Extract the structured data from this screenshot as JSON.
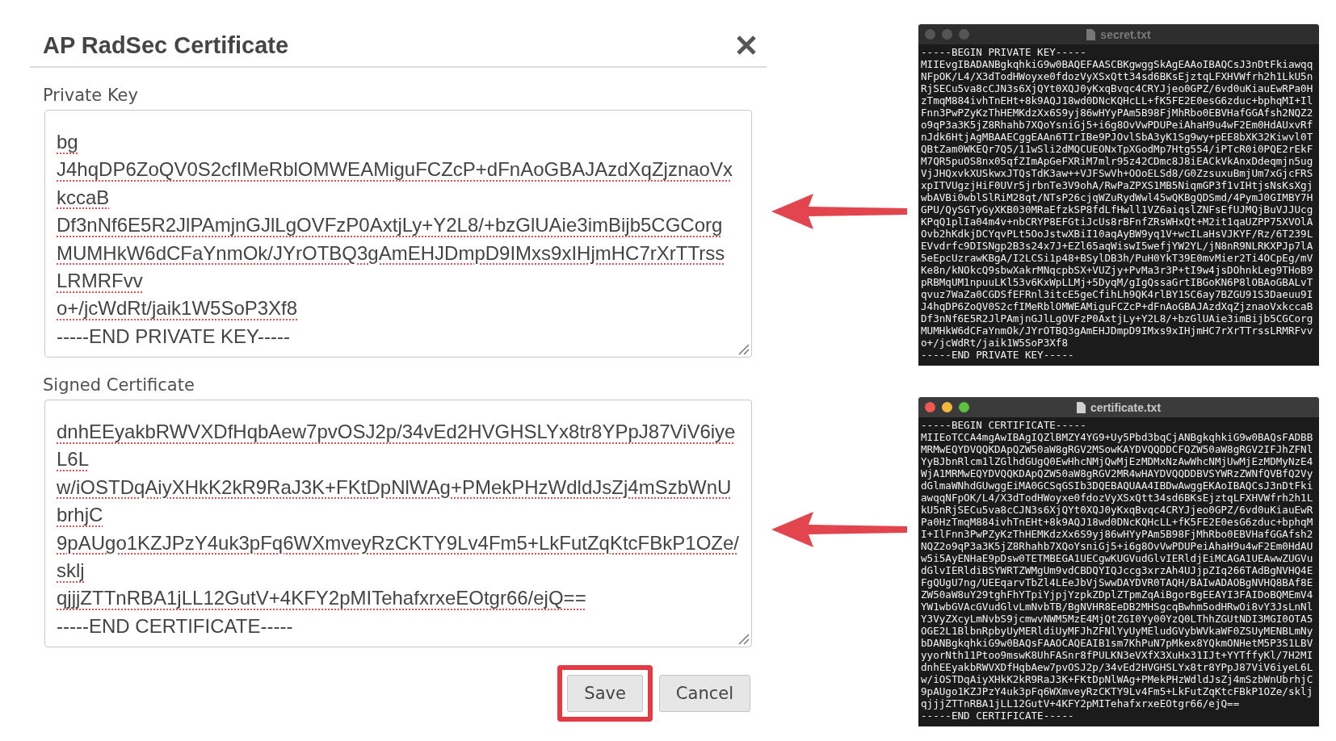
{
  "dialog": {
    "title": "AP RadSec Certificate",
    "fields": [
      {
        "label": "Private Key",
        "lines": [
          {
            "text": "bg",
            "misspelled": true
          },
          {
            "text": "J4hqDP6ZoQV0S2cfIMeRblOMWEAMiguFCZcP+dFnAoGBAJAzdXqZjznaoVx",
            "misspelled": true
          },
          {
            "text": "kccaB",
            "misspelled": true
          },
          {
            "text": "Df3nNf6E5R2JlPAmjnGJlLgOVFzP0AxtjLy+Y2L8/+bzGlUAie3imBijb5CGCorg",
            "misspelled": true
          },
          {
            "text": "MUMHkW6dCFaYnmOk/JYrOTBQ3gAmEHJDmpD9IMxs9xIHjmHC7rXrTTrss",
            "misspelled": true
          },
          {
            "text": "LRMRFvv",
            "misspelled": true
          },
          {
            "text": "o+/jcWdRt/jaik1W5SoP3Xf8",
            "misspelled": true
          },
          {
            "text": "-----END PRIVATE KEY-----",
            "misspelled": false
          }
        ]
      },
      {
        "label": "Signed Certificate",
        "lines": [
          {
            "text": "dnhEEyakbRWVXDfHqbAew7pvOSJ2p/34vEd2HVGHSLYx8tr8YPpJ87ViV6iye",
            "misspelled": true
          },
          {
            "text": "L6L",
            "misspelled": true
          },
          {
            "text": "w/iOSTDqAiyXHkK2kR9RaJ3K+FKtDpNlWAg+PMekPHzWdldJsZj4mSzbWnU",
            "misspelled": true
          },
          {
            "text": "brhjC",
            "misspelled": true
          },
          {
            "text": "9pAUgo1KZJPzY4uk3pFq6WXmveyRzCKTY9Lv4Fm5+LkFutZqKtcFBkP1OZe/",
            "misspelled": true
          },
          {
            "text": "sklj",
            "misspelled": true
          },
          {
            "text": "qjjjZTTnRBA1jLL12GutV+4KFY2pMITehafxrxeEOtgr66/ejQ==",
            "misspelled": true
          },
          {
            "text": "-----END CERTIFICATE-----",
            "misspelled": false
          }
        ]
      }
    ],
    "buttons": [
      {
        "label": "Save",
        "highlighted": true
      },
      {
        "label": "Cancel",
        "highlighted": false
      }
    ]
  },
  "terminals": [
    {
      "title": "secret.txt",
      "active": false,
      "lines": [
        "-----BEGIN PRIVATE KEY-----",
        "MIIEvgIBADANBgkqhkiG9w0BAQEFAASCBKgwggSkAgEAAoIBAQCsJ3nDtFkiawqq",
        "NFpOK/L4/X3dTodHWoyxe0fdozVyXSxQtt34sd6BKsEjztqLFXHVWfrh2h1LkU5n",
        "RjSECu5va8cCJN3s6XjQYt0XQJ0yKxqBvqc4CRYJjeo0GPZ/6vd0uKiauEwRPa0H",
        "zTmqM884ivhTnEHt+8k9AQJ18wd0DNcKQHcLL+fK5FE2E0esG6zduc+bphqMI+Il",
        "Fnn3PwPZyKzThHEMKdzXx6S9yj86wHYyPAm5B98FjMhRbo0EBVHafGGAfsh2NQZ2",
        "o9qP3a3K5jZ8Rhahb7XQoYsniGj5+i6g8OvVwPDUPeiAhaH9u4wF2Em0HdAUxvRf",
        "nJdk6HtjAgMBAAECggEAAn6TIrIBe9PJOvlSbA3yK1Sg9wy+pEE8bXK32Kiwvl0T",
        "QBtZam0WKEQr7Q5/11wSli2dMQCUEONxTpXGodMp7Htg554/iPTcR0i0PQE2rEkF",
        "M7QR5puOS8nx05qfZImApGeFXRiM7mlr95z42CDmc8J8iEACkVkAnxDdeqmjn5ug",
        "VjJHQxvkXUSkwxJTQsTdK3aw++VJFSwVh+OOoELSd8/G0ZzsuxuBmjUm7xGjcFRS",
        "xpITVUgzjHiF0UVr5jrbnTe3V9ohA/RwPaZPXS1MB5NiqmGP3f1vIHtjsNsKsXgj",
        "wbAVBi0wblSlRiM28qt/NTsP26cjqWZuRydWwl45wQKBgQDSmd/4PymJ0GIMBY7H",
        "GPU/QySGTyGyXKB030MRaEfzkSP8fdLfHwll1VZ6aiqslZNFsEfUJMQjBuVJJUcg",
        "KPqQ1plIa04m4v+nbCRYP8EFGtiJcUs8rBFnfZRsWHxQt+M2it1qaUZPP75XVOlA",
        "Ovb2hKdkjDCYqvPLt5OoJstwXBiI10aqAyBW9yq1V+wcILaHsVJKYF/Rz/6T239L",
        "EVvdrfc9DISNgp2B3s24x7J+EZl65aqWiswI5wefjYW2YL/jN8nR9NLRKXPJp7lA",
        "5eEpcUzrawKBgA/I2LCSi1p48+BSylDB3h/PuH0YkT39E0mvMier2Ti4OCpEg/mV",
        "Ke8n/kNOkcQ9sbwXakrMNqcpbSX+VUZjy+PvMa3r3P+tI9w4jsDOhnkLeg9THoB9",
        "pRBMqUM1npuuLKl53v6KxWpLLMj+5DyqM/gIgQssaGrtIBGoKN6P8lOBAoGBALvT",
        "qvuz7WaZa0CGDSfEFRnl3itcE5geCfihLh9QK4rlBY1SC6ay7BZGU91S3Daeuu9I",
        "J4hqDP6ZoQV0S2cfIMeRblOMWEAMiguFCZcP+dFnAoGBAJAzdXqZjznaoVxkccaB",
        "Df3nNf6E5R2JlPAmjnGJlLgOVFzP0AxtjLy+Y2L8/+bzGlUAie3imBijb5CGCorg",
        "MUMHkW6dCFaYnmOk/JYrOTBQ3gAmEHJDmpD9IMxs9xIHjmHC7rXrTTrssLRMRFvv",
        "o+/jcWdRt/jaik1W5SoP3Xf8",
        "-----END PRIVATE KEY-----"
      ]
    },
    {
      "title": "certificate.txt",
      "active": true,
      "lines": [
        "-----BEGIN CERTIFICATE-----",
        "MIIEoTCCA4mgAwIBAgIQZlBMZY4YG9+Uy5Pbd3bqCjANBgkqhkiG9w0BAQsFADBB",
        "MRMwEQYDVQQKDApQZW50aW8gRGV2MSowKAYDVQQDDCFQZW50aW8gRGV2IFJhZFNl",
        "YyBJbnRlcm1lZGlhdGUgQ0EwHhcNMjQwMjEzMDMxNzAwWhcNMjUwMjEzMDMyNzE4",
        "WjA1MRMwEQYDVQQKDApQZW50aW8gRGV2MR4wHAYDVQQDDBVSYWRzZWNfQVBfQ2Vy",
        "dGlmaWNhdGUwggEiMA0GCSqGSIb3DQEBAQUAA4IBDwAwggEKAoIBAQCsJ3nDtFki",
        "awqqNFpOK/L4/X3dTodHWoyxe0fdozVyXSxQtt34sd6BKsEjztqLFXHVWfrh2h1L",
        "kU5nRjSECu5va8cCJN3s6XjQYt0XQJ0yKxqBvqc4CRYJjeo0GPZ/6vd0uKiauEwR",
        "Pa0HzTmqM884ivhTnEHt+8k9AQJ18wd0DNcKQHcLL+fK5FE2E0esG6zduc+bphqM",
        "I+IlFnn3PwPZyKzThHEMKdzXx6S9yj86wHYyPAm5B98FjMhRbo0EBVHafGGAfsh2",
        "NQZ2o9qP3a3K5jZ8Rhahb7XQoYsniGj5+i6g8OvVwPDUPeiAhaH9u4wF2Em0HdAU",
        "w5i5AyENHaE9pDsw0TETMBEGA1UECgwKUGVudGlvIERldjEiMCAGA1UEAwwZUGVu",
        "dGlvIERldiBSYWRTZWMgUm9vdCBDQYIQJccg3xrzAh4UJjpZIq266TAdBgNVHQ4E",
        "FgQUgU7ng/UEEqarvTbZl4LEeJbVjSwwDAYDVR0TAQH/BAIwADAOBgNVHQ8BAf8E",
        "ZW50aW8uY29tghFhYTpiYjpjYzpkZDplZTpmZqAiBgorBgEEAYI3FAIDoBQMEmV4",
        "YW1wbGVAcGVudGlvLmNvbTB/BgNVHR8EeDB2MHSgcqBwhm5odHRwOi8vY3JsLnNl",
        "Y3VyZXcyLmNvbS9jcmwvNWM5MzE4MjQtZGI0Yy00YzQ0LThhZGUtNDI3MGI0OTA5",
        "OGE2L1BlbnRpbyUyMERldiUyMFJhZFNlYyUyMEludGVybWVkaWF0ZSUyMENBLmNy",
        "bDANBgkqhkiG9w0BAQsFAAOCAQEAIB1sm7KhPuN7pMkex8YQkmONHetM5P3S1LBV",
        "yyorNth11Ptoo9mswK8UhFASnr8fPULKN3eVXfX3XuHx31IJt+YYTffyKl/7H2MI",
        "dnhEEyakbRWVXDfHqbAew7pvOSJ2p/34vEd2HVGHSLYx8tr8YPpJ87ViV6iyeL6L",
        "w/iOSTDqAiyXHkK2kR9RaJ3K+FKtDpNlWAg+PMekPHzWdldJsZj4mSzbWnUbrhjC",
        "9pAUgo1KZJPzY4uk3pFq6WXmveyRzCKTY9Lv4Fm5+LkFutZqKtcFBkP1OZe/sklj",
        "qjjjZTTnRBA1jLL12GutV+4KFY2pMITehafxrxeEOtgr66/ejQ==",
        "-----END CERTIFICATE-----"
      ]
    }
  ]
}
